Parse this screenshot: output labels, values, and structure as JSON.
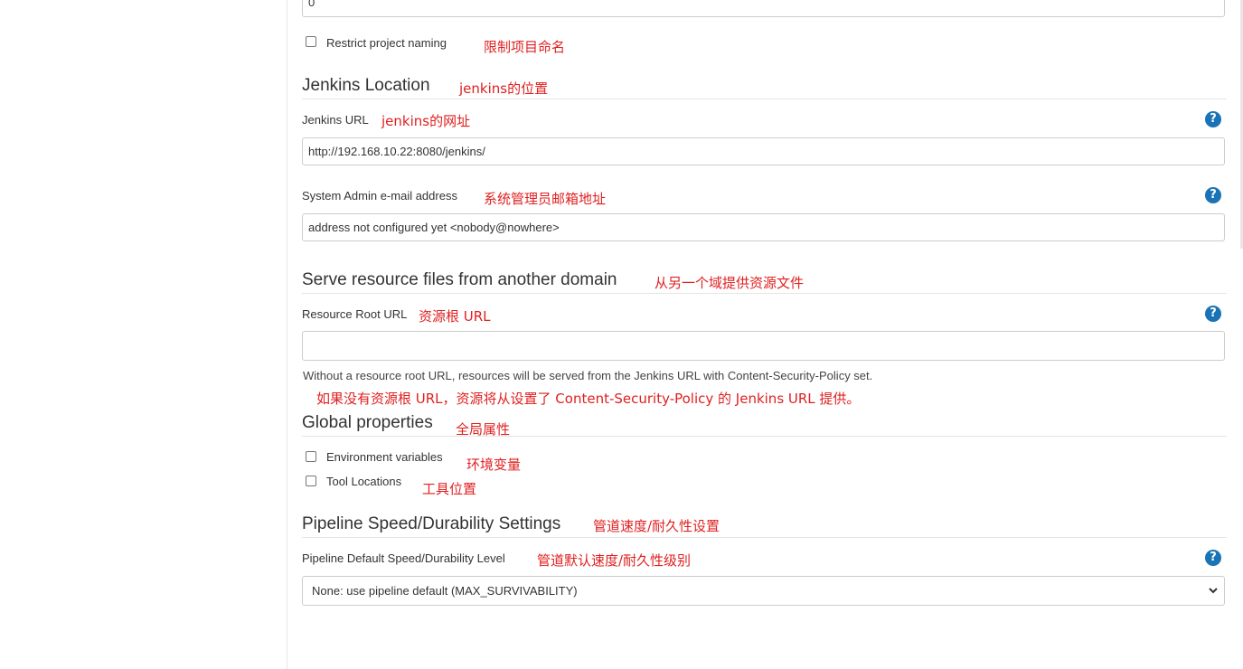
{
  "top_field": {
    "value": "0"
  },
  "restrict_naming": {
    "label": "Restrict project naming",
    "annotation": "限制项目命名",
    "checked": false
  },
  "jenkins_location": {
    "title": "Jenkins Location",
    "annotation": "jenkins的位置",
    "url": {
      "label": "Jenkins URL",
      "annotation": "jenkins的网址",
      "value": "http://192.168.10.22:8080/jenkins/"
    },
    "admin_email": {
      "label": "System Admin e-mail address",
      "annotation": "系统管理员邮箱地址",
      "value": "address not configured yet <nobody@nowhere>"
    }
  },
  "resource_domain": {
    "title": "Serve resource files from another domain",
    "annotation": "从另一个域提供资源文件",
    "root_url": {
      "label": "Resource Root URL",
      "annotation": "资源根 URL",
      "value": ""
    },
    "description": "Without a resource root URL, resources will be served from the Jenkins URL with Content-Security-Policy set.",
    "description_annotation": "如果没有资源根 URL，资源将从设置了 Content-Security-Policy 的 Jenkins URL 提供。"
  },
  "global_properties": {
    "title": "Global properties",
    "annotation": "全局属性",
    "items": [
      {
        "label": "Environment variables",
        "annotation": "环境变量",
        "checked": false
      },
      {
        "label": "Tool Locations",
        "annotation": "工具位置",
        "checked": false
      }
    ]
  },
  "pipeline": {
    "title": "Pipeline Speed/Durability Settings",
    "annotation": "管道速度/耐久性设置",
    "level": {
      "label": "Pipeline Default Speed/Durability Level",
      "annotation": "管道默认速度/耐久性级别",
      "selected": "None: use pipeline default (MAX_SURVIVABILITY)"
    }
  },
  "help_icon": {
    "glyph": "?",
    "icon": "help-icon",
    "color": "#1a73b5"
  },
  "colors": {
    "annotation": "#e02020",
    "accent": "#1a73b5"
  }
}
